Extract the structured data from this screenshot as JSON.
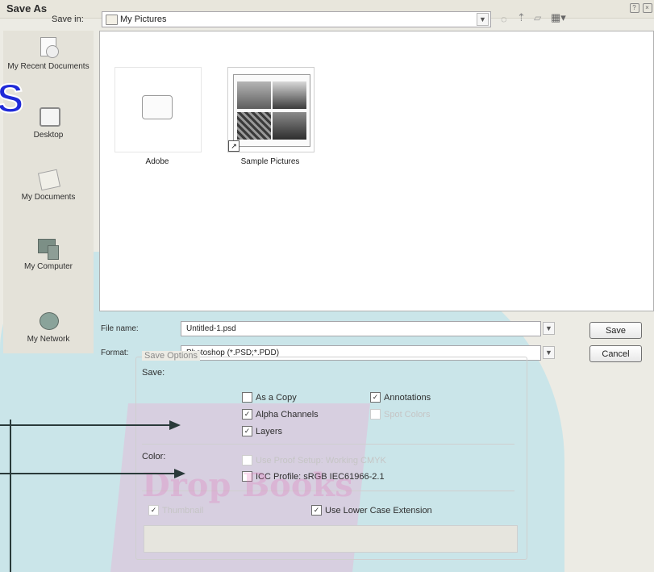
{
  "title": "Save As",
  "save_in": {
    "label": "Save in:",
    "value": "My Pictures"
  },
  "places": [
    {
      "label": "My Recent Documents",
      "icon": "recent-documents-icon"
    },
    {
      "label": "Desktop",
      "icon": "desktop-icon"
    },
    {
      "label": "My Documents",
      "icon": "my-documents-icon"
    },
    {
      "label": "My Computer",
      "icon": "my-computer-icon"
    },
    {
      "label": "My Network",
      "icon": "my-network-icon"
    }
  ],
  "files": [
    {
      "name": "Adobe",
      "type": "folder"
    },
    {
      "name": "Sample Pictures",
      "type": "folder-shortcut"
    }
  ],
  "file_name": {
    "label": "File name:",
    "value": "Untitled-1.psd"
  },
  "format": {
    "label": "Format:",
    "value": "Photoshop (*.PSD;*.PDD)"
  },
  "buttons": {
    "save": "Save",
    "cancel": "Cancel"
  },
  "save_options": {
    "title": "Save Options",
    "save_label": "Save:",
    "as_a_copy": "As a Copy",
    "annotations": "Annotations",
    "alpha_channels": "Alpha Channels",
    "spot_colors": "Spot Colors",
    "layers": "Layers",
    "color_label": "Color:",
    "use_proof_setup": "Use Proof Setup:  Working CMYK",
    "icc_profile": "ICC Profile:  sRGB IEC61966-2.1",
    "thumbnail": "Thumbnail",
    "lower_case": "Use Lower Case Extension"
  },
  "watermark": {
    "letter": "S",
    "brand": "Drop Books"
  },
  "colors": {
    "dialog_bg": "#ecebe4",
    "watermark_teal": "#aee0ec",
    "watermark_magenta": "#f06ac0",
    "letter_blue": "#1f2ad8"
  }
}
